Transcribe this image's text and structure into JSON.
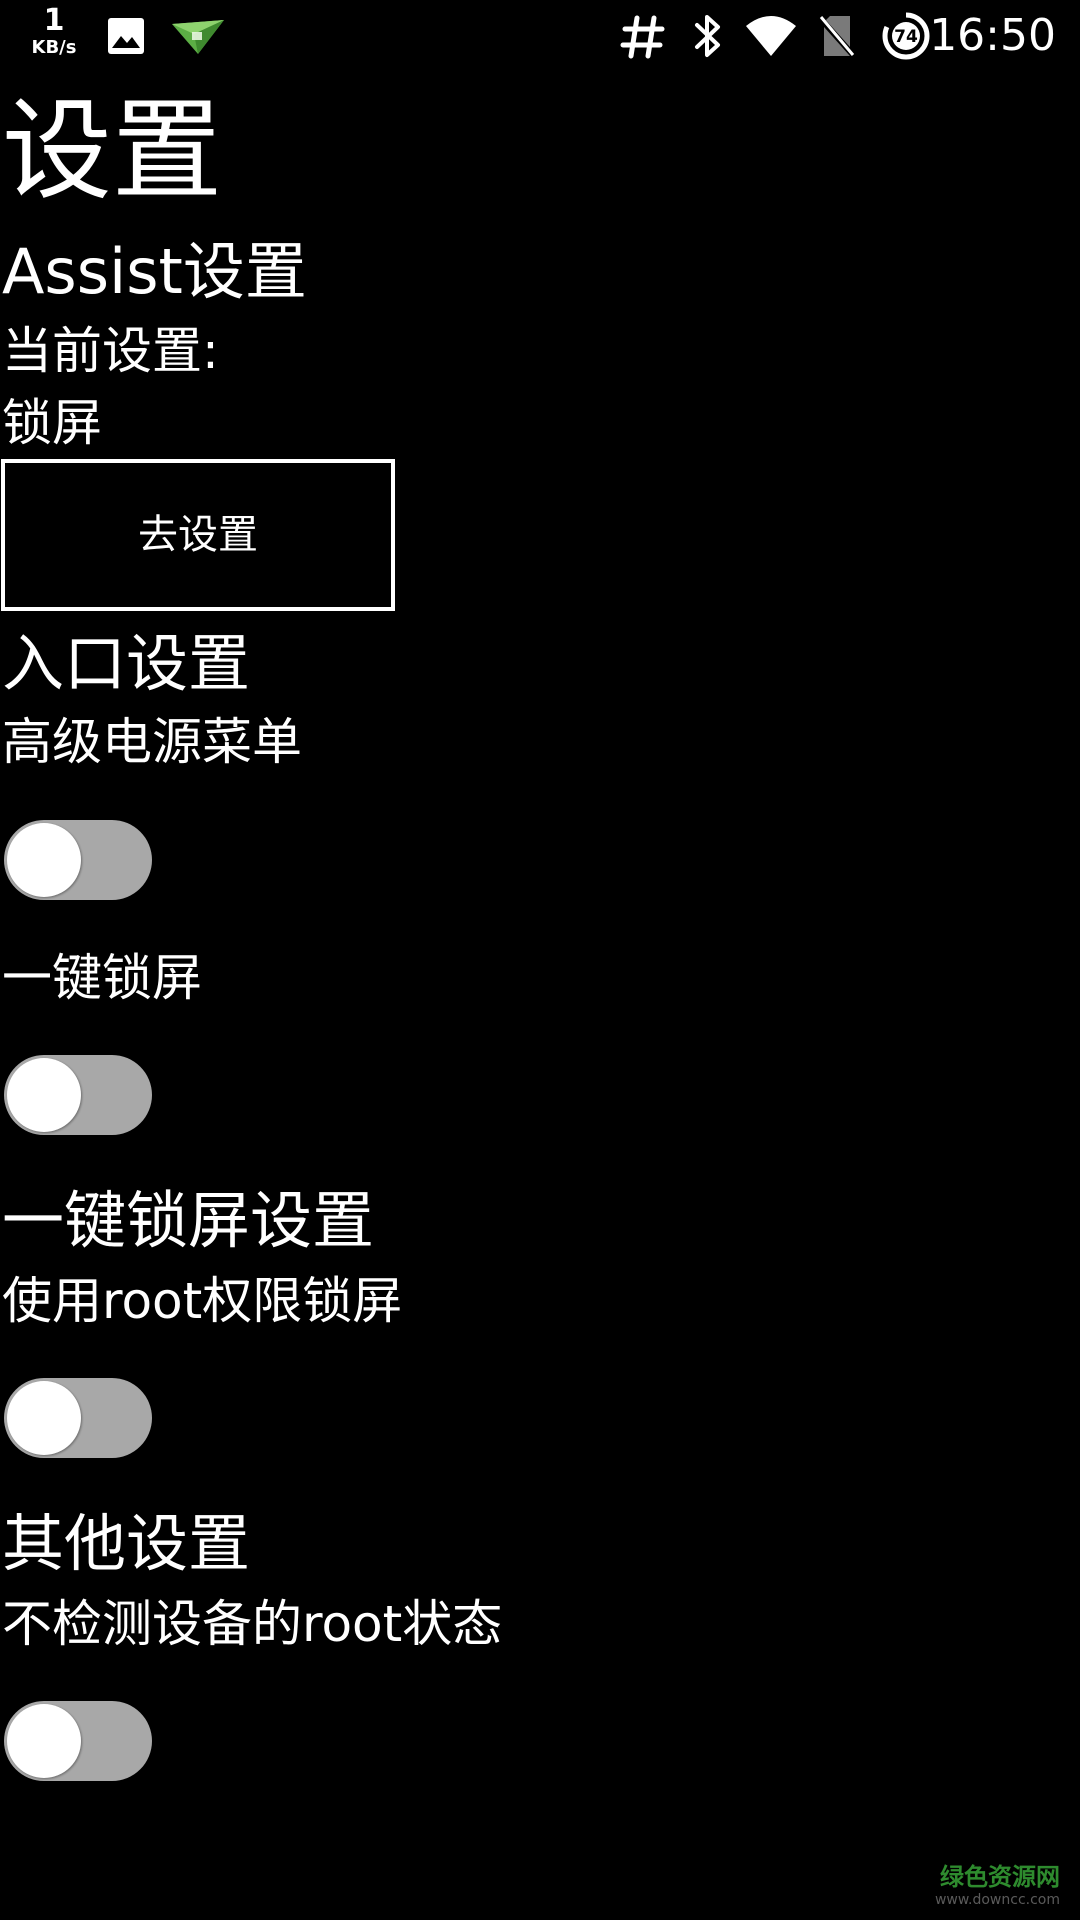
{
  "status_bar": {
    "speed_value": "1",
    "speed_unit": "KB/s",
    "battery_level": "74",
    "time": "16:50",
    "icons": [
      "image-icon",
      "paper-plane-icon",
      "hash-icon",
      "bluetooth-icon",
      "wifi-icon",
      "no-sim-icon",
      "battery-saver-icon"
    ]
  },
  "page": {
    "title": "设置"
  },
  "assist": {
    "title": "Assist设置",
    "current_label": "当前设置:",
    "current_value": "锁屏",
    "button_label": "去设置"
  },
  "entry": {
    "title": "入口设置",
    "items": [
      {
        "label": "高级电源菜单",
        "enabled": false
      },
      {
        "label": "一键锁屏",
        "enabled": false
      }
    ]
  },
  "lock": {
    "title": "一键锁屏设置",
    "items": [
      {
        "label": "使用root权限锁屏",
        "enabled": false
      }
    ]
  },
  "other": {
    "title": "其他设置",
    "items": [
      {
        "label": "不检测设备的root状态",
        "enabled": false
      }
    ]
  },
  "watermark": {
    "text": "绿色资源网",
    "url": "www.downcc.com"
  },
  "colors": {
    "background": "#000000",
    "text": "#ffffff",
    "toggle_track_off": "#a8a8a8",
    "toggle_knob": "#ffffff",
    "watermark_green": "#2e8b2e"
  }
}
